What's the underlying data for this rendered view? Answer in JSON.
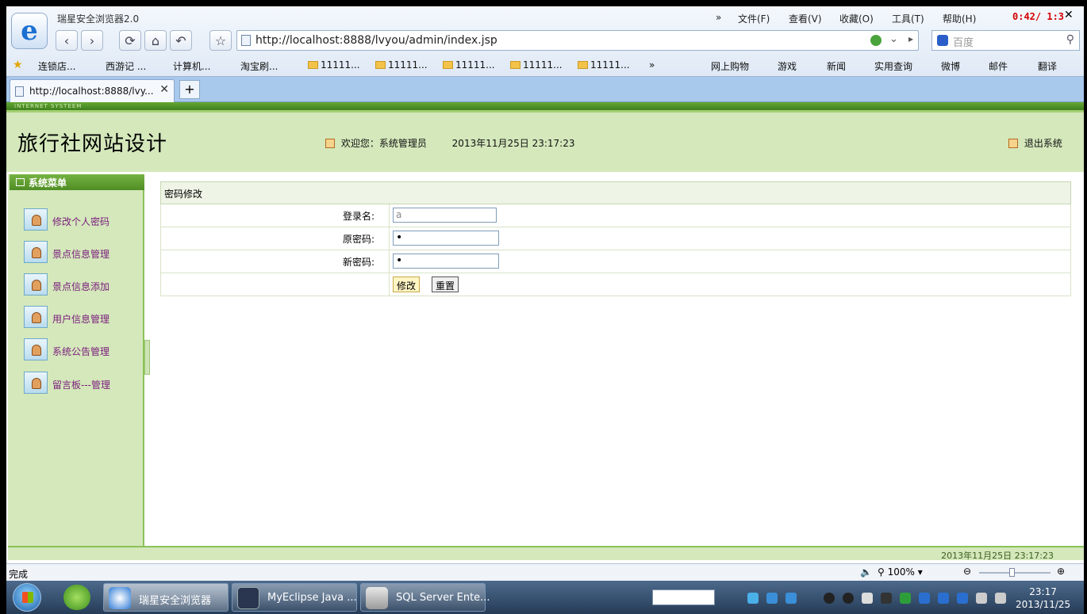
{
  "browser": {
    "brand": "瑞星安全浏览器2.0",
    "menus": [
      "»",
      "文件(F)",
      "查看(V)",
      "收藏(O)",
      "工具(T)",
      "帮助(H)"
    ],
    "url": "http://localhost:8888/lvyou/admin/index.jsp",
    "search_placeholder": "百度",
    "recording_timer": "0:42/ 1:3",
    "bookmarks": [
      "连锁店...",
      "西游记 ...",
      "计算机...",
      "淘宝刷...",
      "11111...",
      "11111...",
      "11111...",
      "11111...",
      "11111...",
      "»"
    ],
    "right_bookmarks": [
      "网上购物",
      "游戏",
      "新闻",
      "实用查询",
      "微博",
      "邮件",
      "翻译"
    ],
    "tab_title": "http://localhost:8888/lvy...",
    "status": "完成",
    "zoom": "100%"
  },
  "page": {
    "header_strip": "INTERNET SYSTEEM",
    "site_title": "旅行社网站设计",
    "welcome": "欢迎您：系统管理员",
    "datetime": "2013年11月25日  23:17:23",
    "logout": "退出系统"
  },
  "sidebar": {
    "title": "系统菜单",
    "items": [
      {
        "label": "修改个人密码"
      },
      {
        "label": "景点信息管理"
      },
      {
        "label": "景点信息添加"
      },
      {
        "label": "用户信息管理"
      },
      {
        "label": "系统公告管理"
      },
      {
        "label": "留言板---管理"
      }
    ]
  },
  "form": {
    "title": "密码修改",
    "login_label": "登录名:",
    "login_value": "a",
    "old_label": "原密码:",
    "old_value": "•",
    "new_label": "新密码:",
    "new_value": "•",
    "submit": "修改",
    "reset": "重置"
  },
  "footer": {
    "datetime": "2013年11月25日  23:17:23"
  },
  "taskbar": {
    "tasks": [
      "瑞星安全浏览器",
      "MyEclipse Java ...",
      "SQL Server Ente..."
    ],
    "time": "23:17",
    "date": "2013/11/25"
  },
  "colors": {
    "header_bg": "#d4e8bb",
    "accent_green": "#4f8d24",
    "menu_text": "#7a1b7c"
  }
}
